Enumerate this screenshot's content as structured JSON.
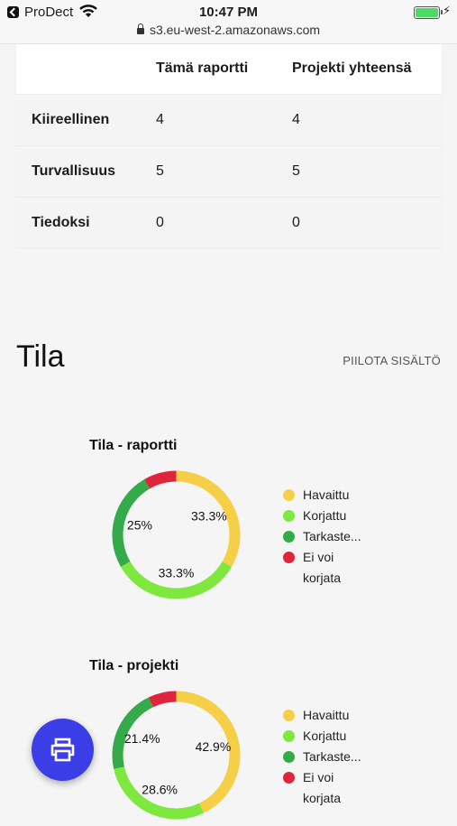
{
  "status_bar": {
    "back_app": "ProDect",
    "time": "10:47 PM",
    "url": "s3.eu-west-2.amazonaws.com"
  },
  "table": {
    "headers": [
      "",
      "Tämä raportti",
      "Projekti yhteensä"
    ],
    "rows": [
      {
        "label": "Kiireellinen",
        "report": "4",
        "project": "4"
      },
      {
        "label": "Turvallisuus",
        "report": "5",
        "project": "5"
      },
      {
        "label": "Tiedoksi",
        "report": "0",
        "project": "0"
      }
    ]
  },
  "section": {
    "title": "Tila",
    "hide_label": "PIILOTA SISÄLTÖ"
  },
  "legend_labels": [
    "Havaittu",
    "Korjattu",
    "Tarkaste...",
    "Ei voi korjata"
  ],
  "colors": {
    "havaittu": "#f4cf47",
    "korjattu": "#7ee83f",
    "tarkaste": "#34aa4a",
    "ei_voi": "#e0243c",
    "fab": "#3b3de6"
  },
  "chart_data": [
    {
      "type": "pie",
      "title": "Tila - raportti",
      "categories": [
        "Havaittu",
        "Korjattu",
        "Tarkaste...",
        "Ei voi korjata"
      ],
      "values": [
        33.3,
        33.3,
        25,
        8.3
      ],
      "labels": [
        "33.3%",
        "33.3%",
        "25%",
        ""
      ]
    },
    {
      "type": "pie",
      "title": "Tila - projekti",
      "categories": [
        "Havaittu",
        "Korjattu",
        "Tarkaste...",
        "Ei voi korjata"
      ],
      "values": [
        42.9,
        28.6,
        21.4,
        7.1
      ],
      "labels": [
        "42.9%",
        "28.6%",
        "21.4%",
        ""
      ]
    }
  ],
  "fab": {
    "icon": "print-icon"
  }
}
